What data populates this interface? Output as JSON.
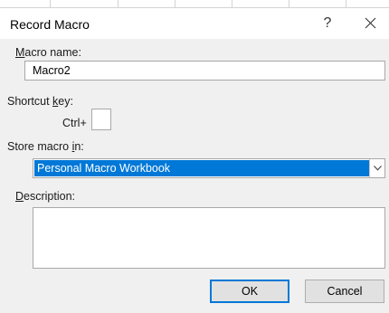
{
  "dialog": {
    "title": "Record Macro",
    "help_glyph": "?",
    "macro_name": {
      "label_access_key": "M",
      "label_rest": "acro name:",
      "value": "Macro2"
    },
    "shortcut_key": {
      "label_start": "Shortcut ",
      "label_access_key": "k",
      "label_end": "ey:",
      "prefix": "Ctrl+",
      "value": ""
    },
    "store_macro_in": {
      "label_start": "Store macro ",
      "label_access_key": "i",
      "label_end": "n:",
      "selected": "Personal Macro Workbook"
    },
    "description": {
      "label_access_key": "D",
      "label_rest": "escription:",
      "value": ""
    },
    "buttons": {
      "ok": "OK",
      "cancel": "Cancel"
    }
  },
  "colors": {
    "accent": "#0078d7",
    "dialog_bg": "#f0f0f0",
    "button_bg": "#e1e1e1"
  },
  "icons": {
    "close": "close-icon",
    "dropdown": "chevron-down-icon"
  }
}
